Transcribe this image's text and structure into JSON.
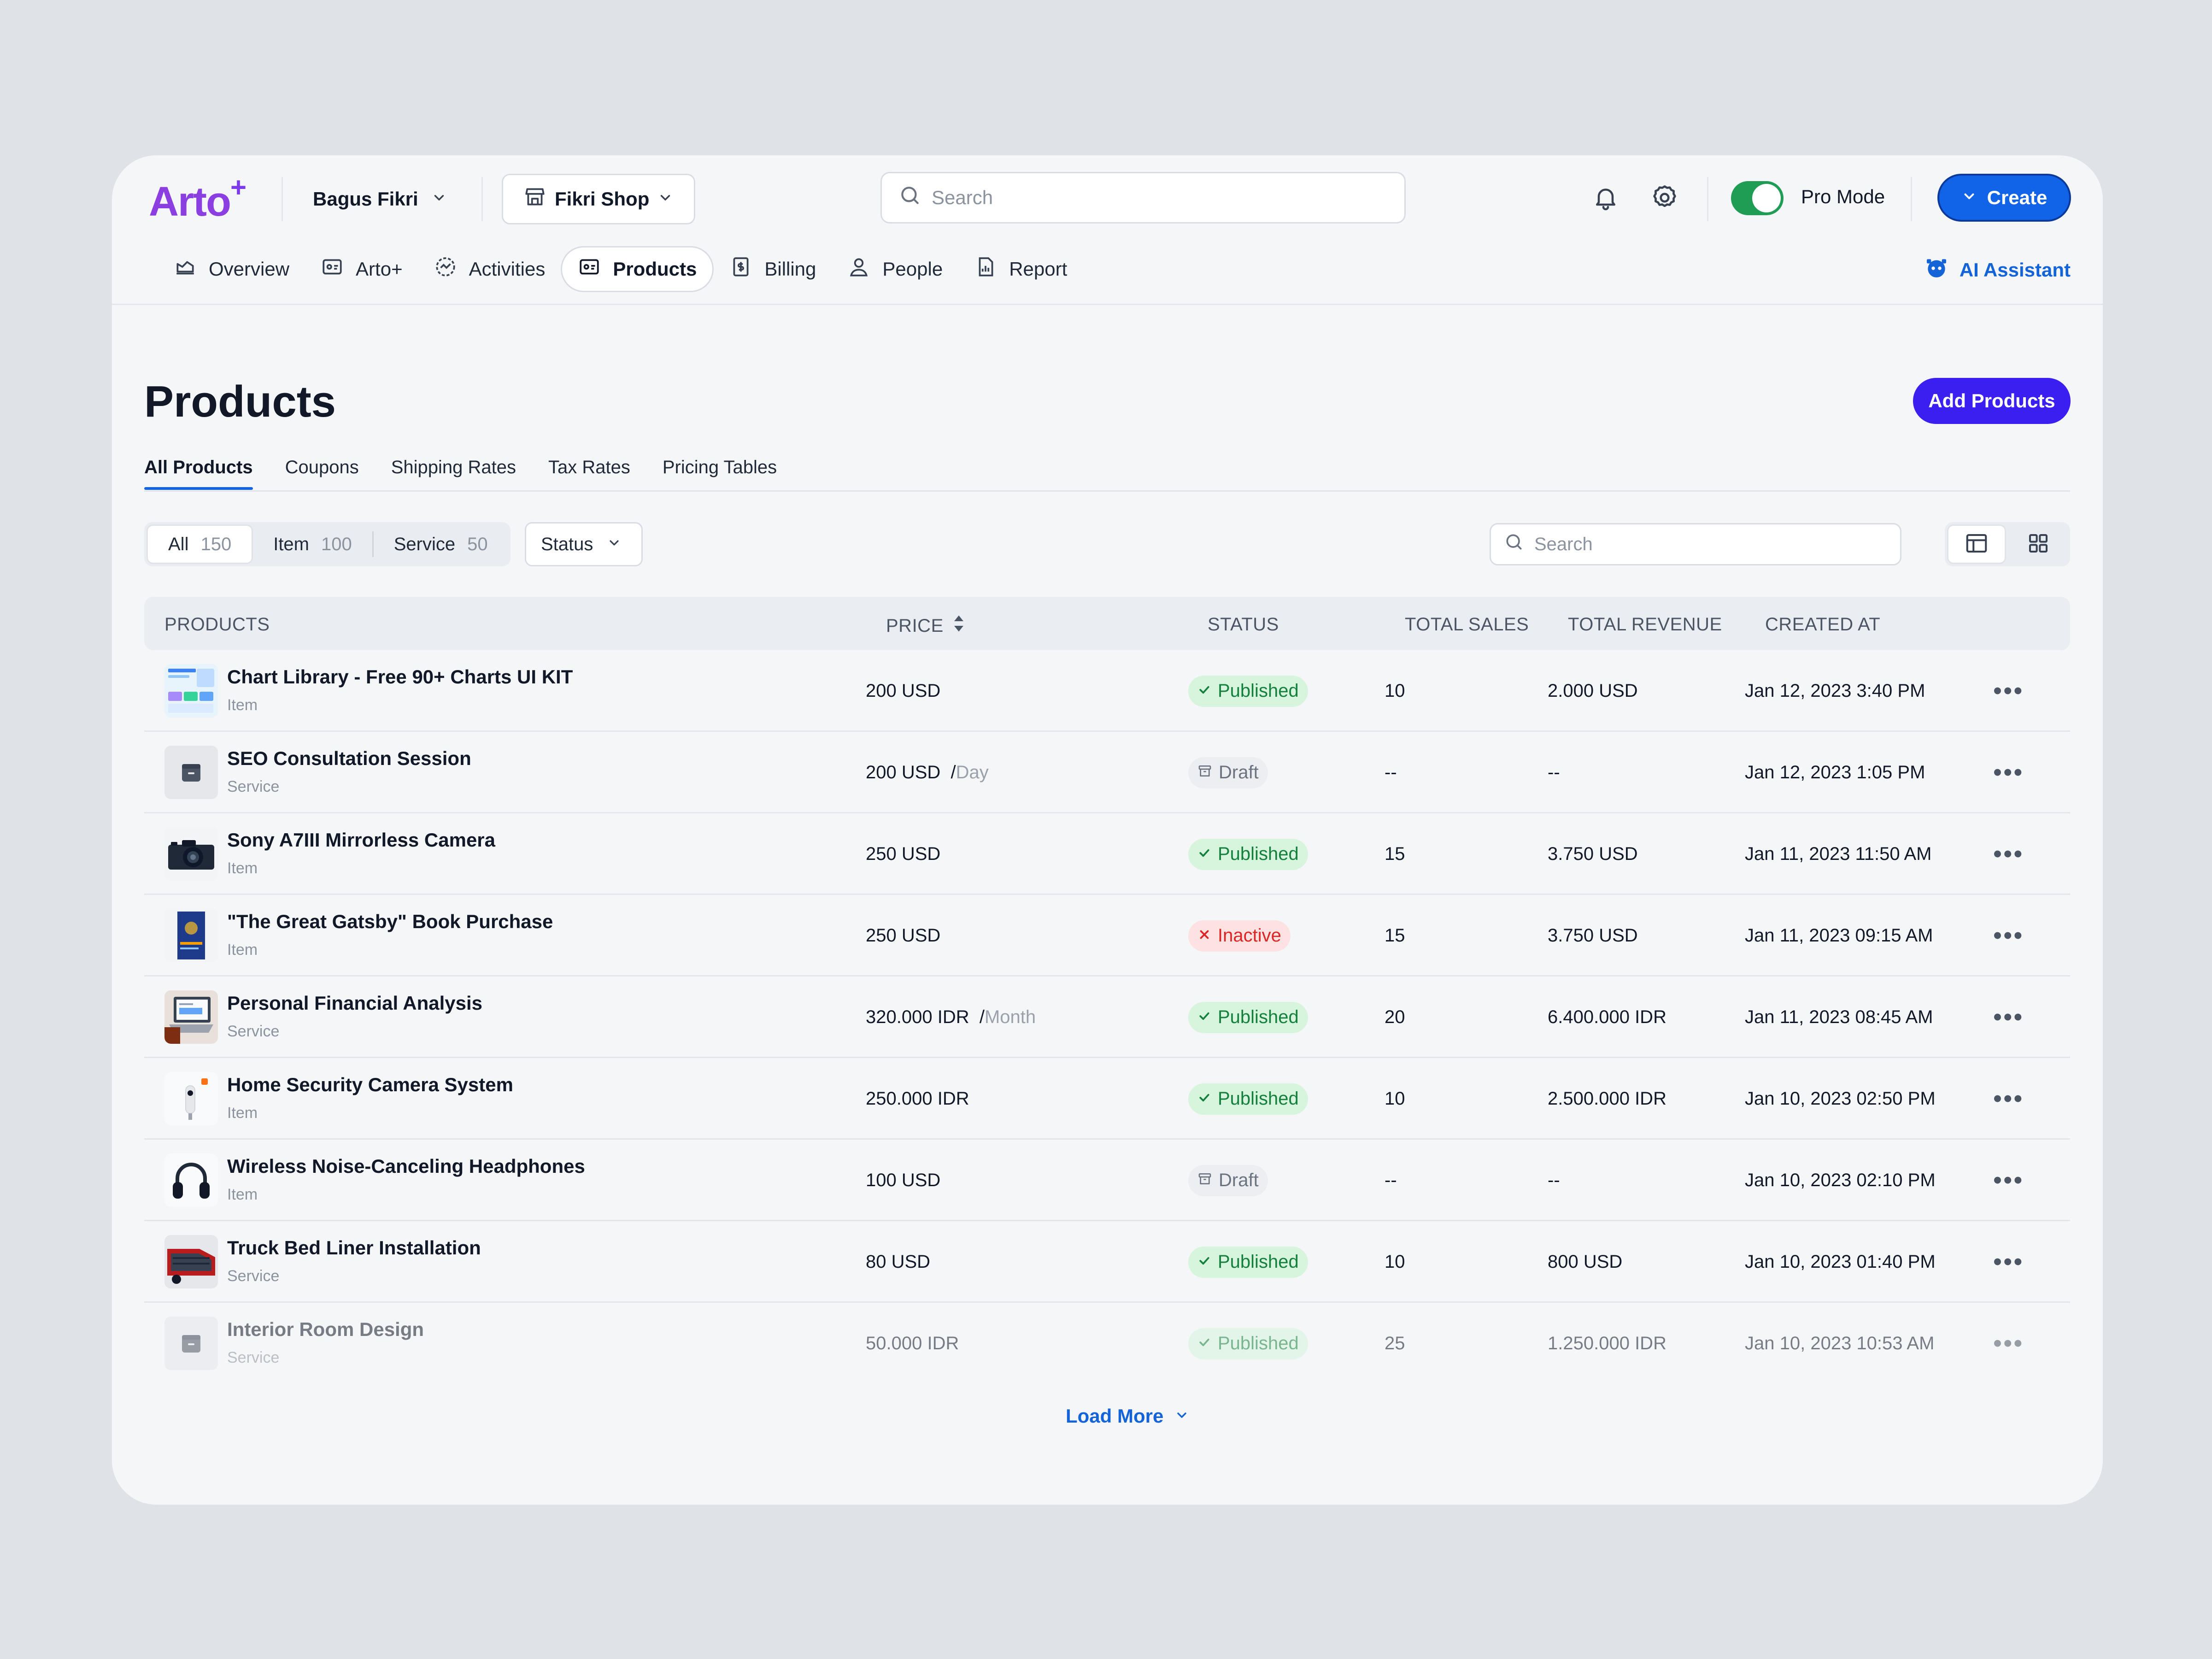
{
  "app": {
    "logo": "Arto",
    "logo_plus": "+"
  },
  "header": {
    "user": "Bagus Fikri",
    "shop": "Fikri Shop",
    "search_placeholder": "Search",
    "pro_mode_label": "Pro Mode",
    "pro_mode_on": true,
    "create_label": "Create"
  },
  "nav": {
    "items": [
      {
        "label": "Overview",
        "icon": "chart-area-icon"
      },
      {
        "label": "Arto+",
        "icon": "id-card-icon"
      },
      {
        "label": "Activities",
        "icon": "activity-icon"
      },
      {
        "label": "Products",
        "icon": "product-card-icon",
        "active": true
      },
      {
        "label": "Billing",
        "icon": "receipt-icon"
      },
      {
        "label": "People",
        "icon": "user-icon"
      },
      {
        "label": "Report",
        "icon": "report-icon"
      }
    ],
    "ai_assistant": "AI Assistant"
  },
  "page": {
    "title": "Products",
    "add_button": "Add Products",
    "tabs": [
      "All Products",
      "Coupons",
      "Shipping Rates",
      "Tax Rates",
      "Pricing Tables"
    ]
  },
  "filters": {
    "segments": [
      {
        "label": "All",
        "count": "150"
      },
      {
        "label": "Item",
        "count": "100"
      },
      {
        "label": "Service",
        "count": "50"
      }
    ],
    "status_label": "Status",
    "search_placeholder": "Search"
  },
  "table": {
    "headers": {
      "products": "PRODUCTS",
      "price": "PRICE",
      "status": "STATUS",
      "total_sales": "TOTAL SALES",
      "total_revenue": "TOTAL REVENUE",
      "created_at": "CREATED AT"
    },
    "rows": [
      {
        "name": "Chart Library - Free 90+ Charts UI KIT",
        "type": "Item",
        "price": "200 USD",
        "per": "",
        "status": "Published",
        "sales": "10",
        "revenue": "2.000 USD",
        "created": "Jan 12, 2023 3:40 PM",
        "thumb": "chart"
      },
      {
        "name": "SEO Consultation Session",
        "type": "Service",
        "price": "200 USD",
        "per": "Day",
        "status": "Draft",
        "sales": "--",
        "revenue": "--",
        "created": "Jan 12, 2023 1:05 PM",
        "thumb": "box"
      },
      {
        "name": "Sony A7III Mirrorless Camera",
        "type": "Item",
        "price": "250 USD",
        "per": "",
        "status": "Published",
        "sales": "15",
        "revenue": "3.750 USD",
        "created": "Jan 11, 2023 11:50 AM",
        "thumb": "camera"
      },
      {
        "name": "\"The Great Gatsby\" Book Purchase",
        "type": "Item",
        "price": "250 USD",
        "per": "",
        "status": "Inactive",
        "sales": "15",
        "revenue": "3.750 USD",
        "created": "Jan 11, 2023 09:15 AM",
        "thumb": "book"
      },
      {
        "name": "Personal Financial Analysis",
        "type": "Service",
        "price": "320.000 IDR",
        "per": "Month",
        "status": "Published",
        "sales": "20",
        "revenue": "6.400.000 IDR",
        "created": "Jan 11, 2023 08:45 AM",
        "thumb": "laptop"
      },
      {
        "name": "Home Security Camera System",
        "type": "Item",
        "price": "250.000 IDR",
        "per": "",
        "status": "Published",
        "sales": "10",
        "revenue": "2.500.000 IDR",
        "created": "Jan 10, 2023 02:50 PM",
        "thumb": "security"
      },
      {
        "name": "Wireless Noise-Canceling Headphones",
        "type": "Item",
        "price": "100 USD",
        "per": "",
        "status": "Draft",
        "sales": "--",
        "revenue": "--",
        "created": "Jan 10, 2023 02:10 PM",
        "thumb": "headphones"
      },
      {
        "name": "Truck Bed Liner Installation",
        "type": "Service",
        "price": "80 USD",
        "per": "",
        "status": "Published",
        "sales": "10",
        "revenue": "800 USD",
        "created": "Jan 10, 2023 01:40 PM",
        "thumb": "truck"
      },
      {
        "name": "Interior Room Design",
        "type": "Service",
        "price": "50.000 IDR",
        "per": "",
        "status": "Published",
        "sales": "25",
        "revenue": "1.250.000 IDR",
        "created": "Jan 10, 2023 10:53 AM",
        "thumb": "box"
      }
    ]
  },
  "load_more": "Load More",
  "colors": {
    "accent": "#1163e8",
    "brand": "#8b3fe0",
    "add_button": "#3b1ff0",
    "published": "#15803d",
    "inactive": "#dc2626"
  }
}
